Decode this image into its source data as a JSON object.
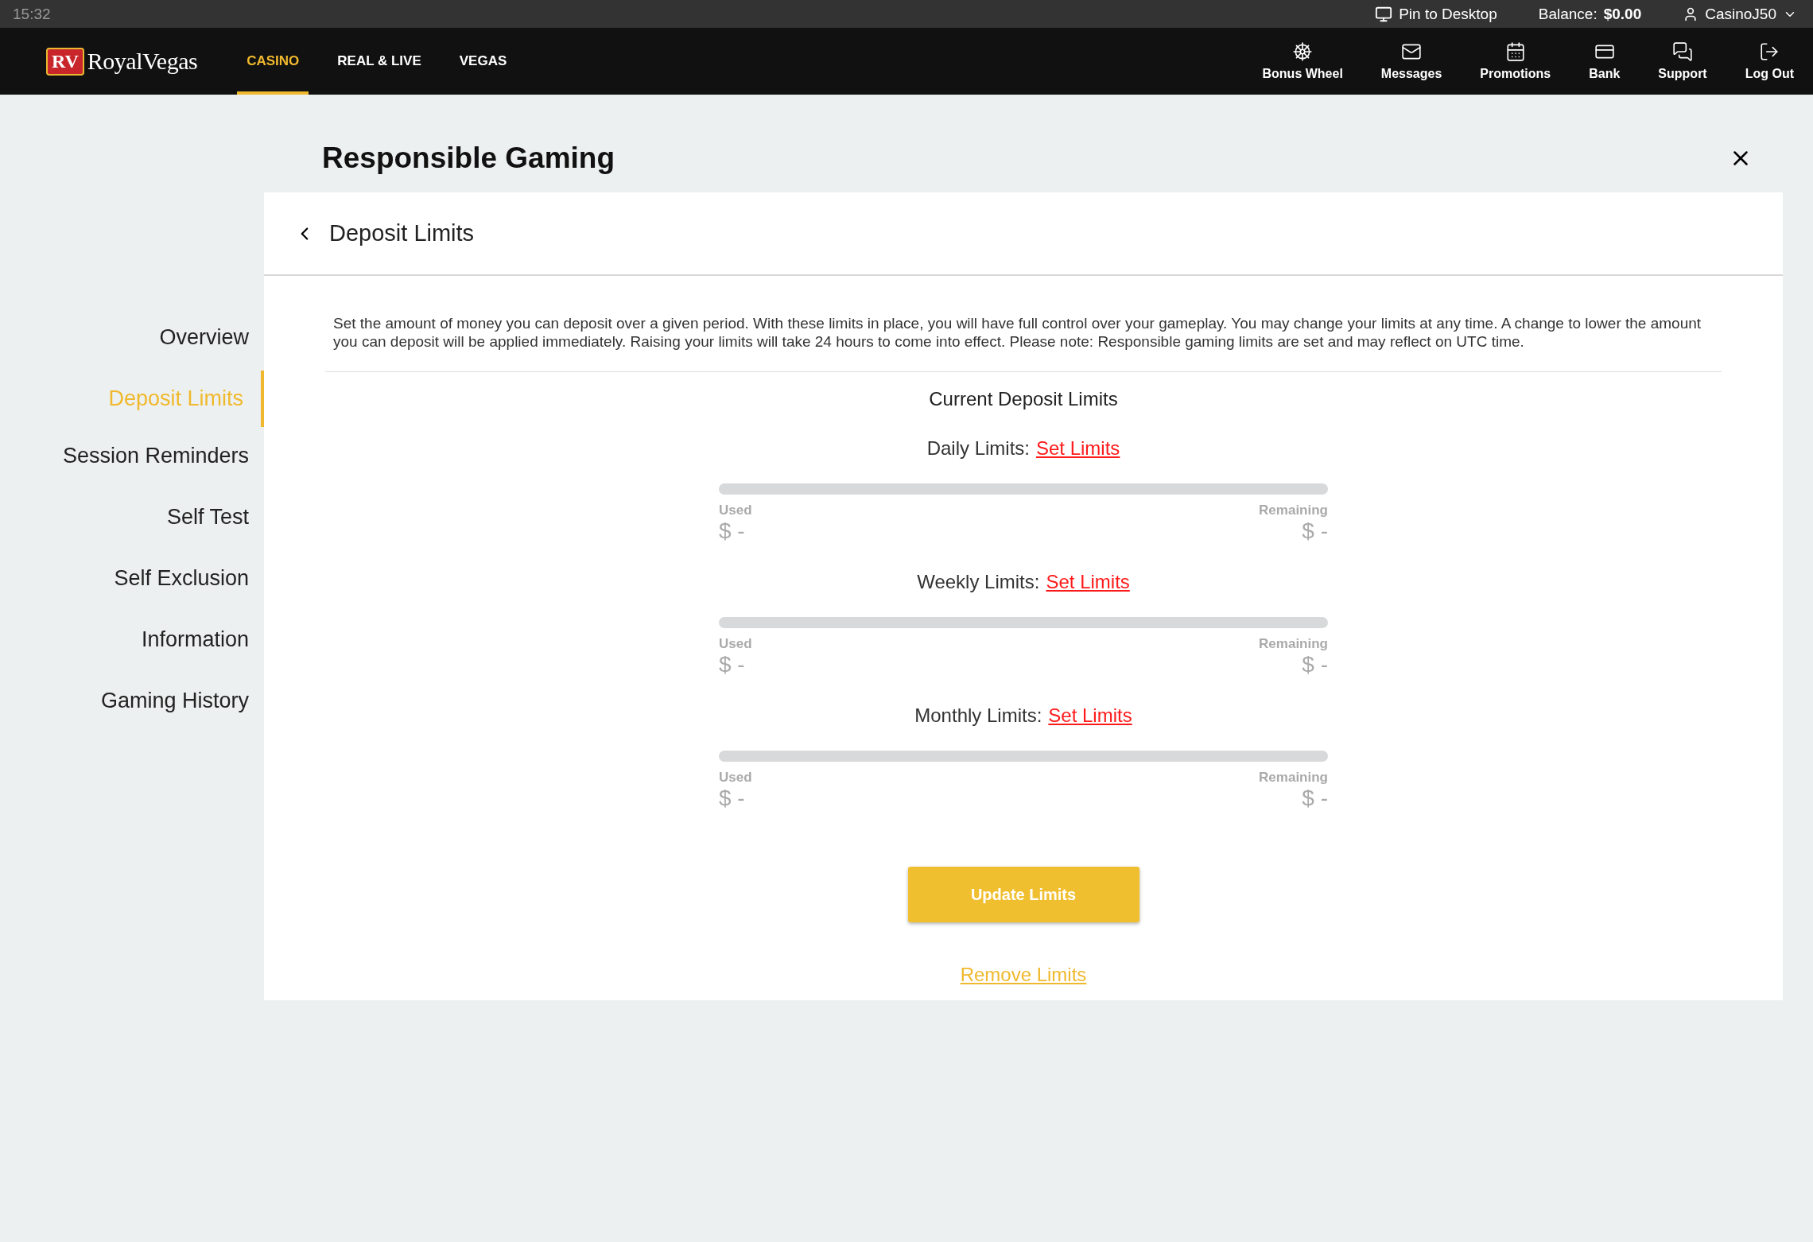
{
  "status_bar": {
    "time": "15:32",
    "pin": "Pin to Desktop",
    "balance_label": "Balance:",
    "balance_value": "$0.00",
    "user": "CasinoJ50"
  },
  "logo": {
    "badge": "RV",
    "name": "RoyalVegas"
  },
  "nav_tabs": [
    {
      "label": "CASINO",
      "selected": true
    },
    {
      "label": "REAL & LIVE",
      "selected": false
    },
    {
      "label": "VEGAS",
      "selected": false
    }
  ],
  "nav_actions": [
    {
      "kind": "wheel",
      "label": "Bonus Wheel"
    },
    {
      "kind": "mail",
      "label": "Messages"
    },
    {
      "kind": "calendar",
      "label": "Promotions"
    },
    {
      "kind": "bank",
      "label": "Bank"
    },
    {
      "kind": "chat",
      "label": "Support"
    },
    {
      "kind": "logout",
      "label": "Log Out"
    }
  ],
  "page_title": "Responsible Gaming",
  "sidebar": {
    "items": [
      {
        "label": "Overview",
        "selected": false
      },
      {
        "label": "Deposit Limits",
        "selected": true
      },
      {
        "label": "Session Reminders",
        "selected": false
      },
      {
        "label": "Self Test",
        "selected": false
      },
      {
        "label": "Self Exclusion",
        "selected": false
      },
      {
        "label": "Information",
        "selected": false
      },
      {
        "label": "Gaming History",
        "selected": false
      }
    ]
  },
  "panel": {
    "title": "Deposit Limits",
    "description": "Set the amount of money you can deposit over a given period. With these limits in place, you will have full control over your gameplay. You may change your limits at any time. A change to lower the amount you can deposit will be applied immediately. Raising your limits will take 24 hours to come into effect. Please note: Responsible gaming limits are set and may reflect on UTC time.",
    "section_title": "Current Deposit Limits",
    "limits": [
      {
        "label": "Daily Limits:",
        "link": "Set Limits",
        "level": 0,
        "used_label": "Used",
        "used_value": "$ -",
        "remaining_label": "Remaining",
        "remaining_value": "$ -"
      },
      {
        "label": "Weekly Limits:",
        "link": "Set Limits",
        "level": 0,
        "used_label": "Used",
        "used_value": "$ -",
        "remaining_label": "Remaining",
        "remaining_value": "$ -"
      },
      {
        "label": "Monthly Limits:",
        "link": "Set Limits",
        "level": 0,
        "used_label": "Used",
        "used_value": "$ -",
        "remaining_label": "Remaining",
        "remaining_value": "$ -"
      }
    ],
    "update_button": "Update Limits",
    "remove_link": "Remove Limits"
  }
}
